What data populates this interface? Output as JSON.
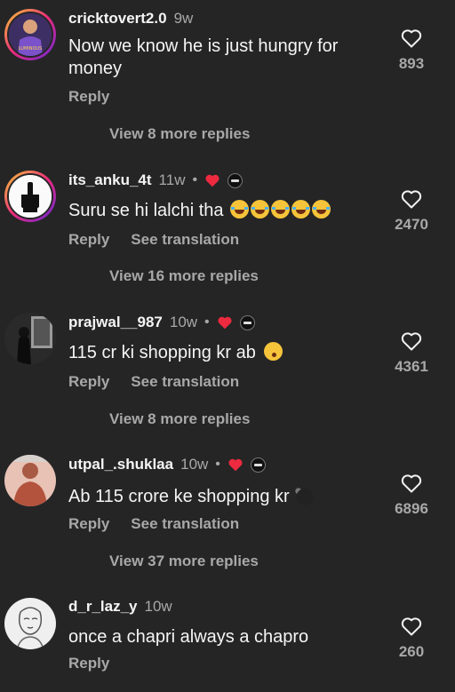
{
  "comments": [
    {
      "username": "cricktovert2.0",
      "time": "9w",
      "text": "Now we know he is just hungry for money",
      "reply": "Reply",
      "see_translation": "",
      "view_more": "View 8 more replies",
      "likes": "893",
      "has_author_heart": false,
      "avatar_icon": "cricketer-avatar-icon",
      "jersey_text": "LUMINOUS"
    },
    {
      "username": "its_anku_4t",
      "time": "11w",
      "text": "Suru se hi lalchi tha",
      "reply": "Reply",
      "see_translation": "See translation",
      "view_more": "View 16 more replies",
      "likes": "2470",
      "has_author_heart": true,
      "avatar_icon": "skeleton-hand-avatar-icon",
      "emoji": "laughing-tears-emoji x5"
    },
    {
      "username": "prajwal__987",
      "time": "10w",
      "text": "115 cr ki shopping kr ab",
      "reply": "Reply",
      "see_translation": "See translation",
      "view_more": "View 8 more replies",
      "likes": "4361",
      "has_author_heart": true,
      "avatar_icon": "dark-photo-avatar-icon",
      "emoji": "kissing-face-emoji"
    },
    {
      "username": "utpal_.shuklaa",
      "time": "10w",
      "text": "Ab 115 crore ke shopping kr",
      "reply": "Reply",
      "see_translation": "See translation",
      "view_more": "View 37 more replies",
      "likes": "6896",
      "has_author_heart": true,
      "avatar_icon": "person-photo-avatar-icon",
      "sticker": "blurred-sticker"
    },
    {
      "username": "d_r_laz_y",
      "time": "10w",
      "text": "once a chapri always a chapro",
      "reply": "Reply",
      "see_translation": "",
      "view_more": "",
      "likes": "260",
      "has_author_heart": false,
      "avatar_icon": "sketch-avatar-icon"
    }
  ],
  "colors": {
    "background": "#252526",
    "primary_text": "#f5f5f5",
    "secondary_text": "#a8a8a8",
    "author_heart": "#ed2a3f"
  }
}
